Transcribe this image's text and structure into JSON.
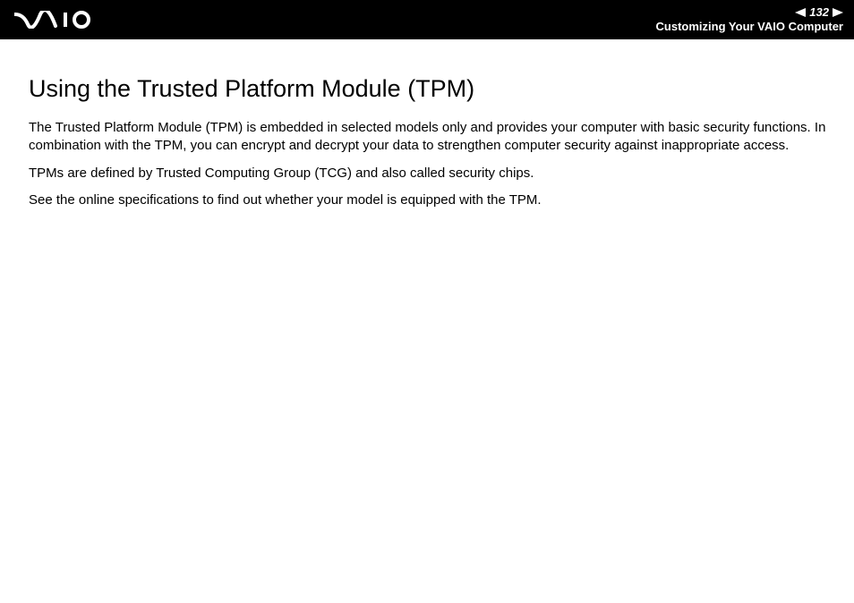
{
  "header": {
    "page_number": "132",
    "section": "Customizing Your VAIO Computer"
  },
  "content": {
    "title": "Using the Trusted Platform Module (TPM)",
    "paragraphs": [
      "The Trusted Platform Module (TPM) is embedded in selected models only and provides your computer with basic security functions. In combination with the TPM, you can encrypt and decrypt your data to strengthen computer security against inappropriate access.",
      "TPMs are defined by Trusted Computing Group (TCG) and also called security chips.",
      "See the online specifications to find out whether your model is equipped with the TPM."
    ]
  }
}
